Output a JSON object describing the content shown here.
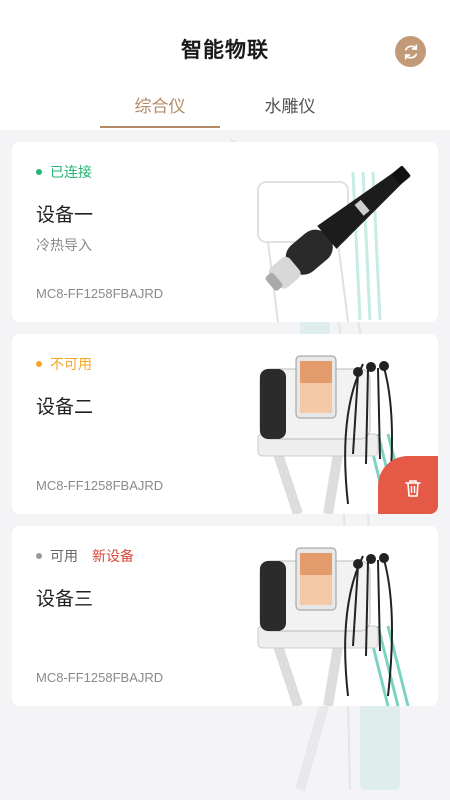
{
  "header": {
    "title": "智能物联",
    "refresh_icon": "refresh-icon"
  },
  "tabs": [
    {
      "label": "综合仪",
      "active": true
    },
    {
      "label": "水雕仪",
      "active": false
    }
  ],
  "colors": {
    "accent": "#b58b66",
    "connected": "#22b573",
    "unavailable": "#f5a623",
    "available": "#999999",
    "new_tag": "#d9483b",
    "delete": "#e55a47"
  },
  "devices": [
    {
      "status": "已连接",
      "status_color": "#22b573",
      "name": "设备一",
      "type": "冷热导入",
      "id": "MC8-FF1258FBAJRD",
      "image": "handpiece-device"
    },
    {
      "status": "不可用",
      "status_color": "#f5a623",
      "name": "设备二",
      "id": "MC8-FF1258FBAJRD",
      "image": "beauty-machine",
      "delete_icon": "trash-icon"
    },
    {
      "status": "可用",
      "status_color": "#999999",
      "new_tag": "新设备",
      "name": "设备三",
      "id": "MC8-FF1258FBAJRD",
      "image": "beauty-machine"
    }
  ]
}
